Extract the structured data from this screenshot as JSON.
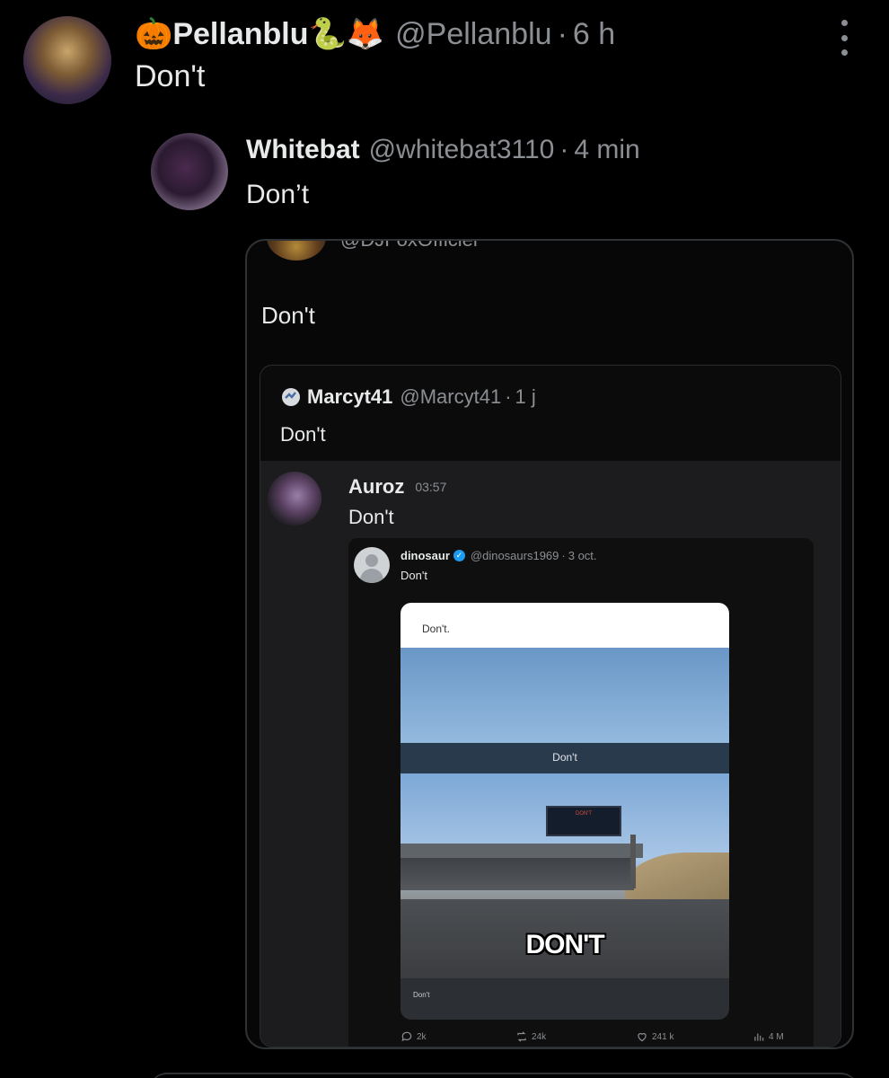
{
  "post": {
    "name": "🎃Pellanblu🐍🦊",
    "handle": "@Pellanblu",
    "sep": "·",
    "time": "6 h",
    "text": "Don't"
  },
  "reply": {
    "name": "Whitebat",
    "handle": "@whitebat3110",
    "sep": "·",
    "time": "4 min",
    "text": "Don’t"
  },
  "quote1": {
    "handle_cut": "@DJFoxOfficiel",
    "text": "Don't"
  },
  "quote2": {
    "name": "Marcyt41",
    "handle": "@Marcyt41",
    "sep": "·",
    "time": "1 j",
    "text": "Don't"
  },
  "message": {
    "name": "Auroz",
    "time": "03:57",
    "text": "Don't"
  },
  "inner_tweet": {
    "name": "dinosaur",
    "handle": "@dinosaurs1969",
    "sep": "·",
    "time": "3 oct.",
    "text": "Don't",
    "stats": {
      "replies": "2k",
      "reposts": "24k",
      "likes": "241 k",
      "views": "4 M"
    }
  },
  "meme": {
    "top_text": "Don't.",
    "band_text": "Don't",
    "billboard_text": "DON'T",
    "caption": "DON'T",
    "bottom_text": "Don't"
  },
  "colors": {
    "background": "#000000",
    "text": "#e7e9ea",
    "muted": "#8b8f94",
    "border": "#2f3336",
    "verified": "#1d9bf0"
  }
}
